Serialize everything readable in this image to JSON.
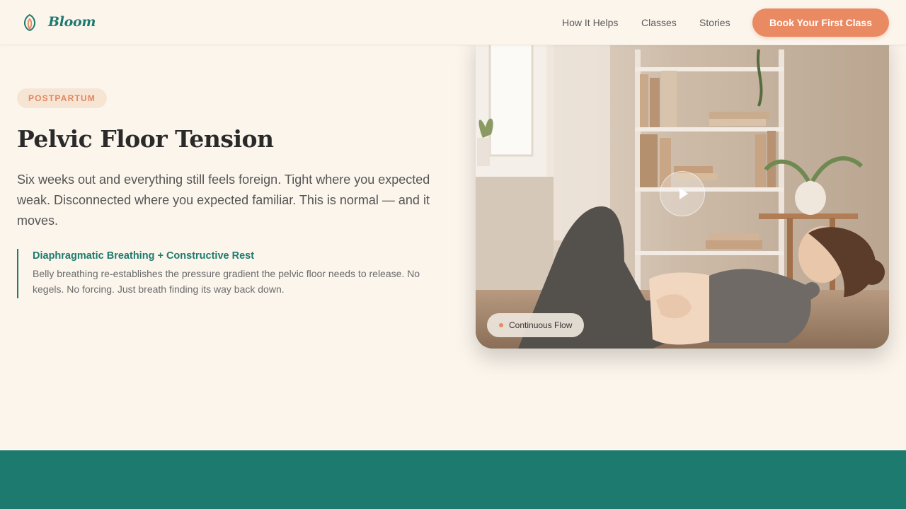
{
  "brand": {
    "name": "Bloom",
    "logo_icon": "bloom-leaf-icon"
  },
  "nav": {
    "links": [
      "How It Helps",
      "Classes",
      "Stories"
    ],
    "cta_label": "Book Your First Class"
  },
  "hero": {
    "tag": "POSTPARTUM",
    "title": "Pelvic Floor Tension",
    "lead": "Six weeks out and everything still feels foreign. Tight where you expected weak. Disconnected where you expected familiar. This is normal — and it moves.",
    "technique": {
      "title": "Diaphragmatic Breathing + Constructive Rest",
      "description": "Belly breathing re-establishes the pressure gradient the pelvic floor needs to release. No kegels. No forcing. Just breath finding its way back down."
    }
  },
  "media": {
    "play_icon": "play-icon",
    "chip_label": "Continuous Flow"
  },
  "colors": {
    "background": "#fbf5ec",
    "accent": "#ea8a63",
    "brand": "#1e7a6e",
    "footer_band": "#1c7a6e"
  }
}
